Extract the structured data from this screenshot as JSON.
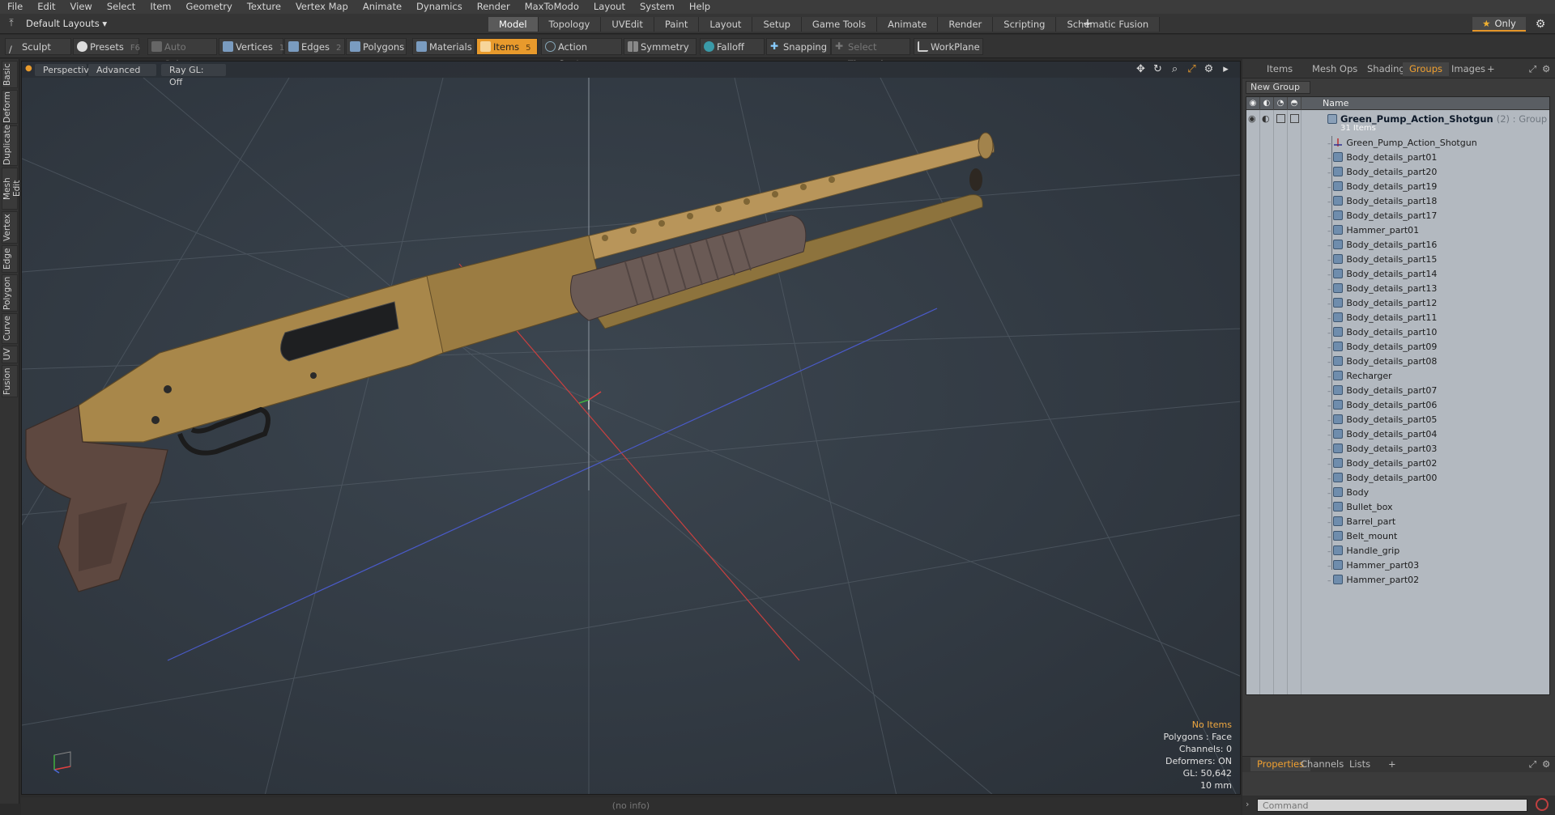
{
  "menu": [
    "File",
    "Edit",
    "View",
    "Select",
    "Item",
    "Geometry",
    "Texture",
    "Vertex Map",
    "Animate",
    "Dynamics",
    "Render",
    "MaxToModo",
    "Layout",
    "System",
    "Help"
  ],
  "layout_select": "Default Layouts",
  "workspace_tabs": [
    "Model",
    "Topology",
    "UVEdit",
    "Paint",
    "Layout",
    "Setup",
    "Game Tools",
    "Animate",
    "Render",
    "Scripting",
    "Schematic Fusion"
  ],
  "workspace_active": "Model",
  "only_label": "Only",
  "toolbar": {
    "sculpt": "Sculpt",
    "presets": "Presets",
    "presets_key": "F6",
    "auto_select": "Auto Select",
    "vertices": "Vertices",
    "vertices_key": "1",
    "edges": "Edges",
    "edges_key": "2",
    "polygons": "Polygons",
    "materials": "Materials",
    "items": "Items",
    "items_key": "5",
    "action_center": "Action Center",
    "symmetry": "Symmetry",
    "falloff": "Falloff",
    "snapping": "Snapping",
    "select_through": "Select Through",
    "workplane": "WorkPlane"
  },
  "left_tabs": [
    "Basic",
    "Deform",
    "Duplicate",
    "Mesh Edit",
    "Vertex",
    "Edge",
    "Polygon",
    "Curve",
    "UV",
    "Fusion"
  ],
  "viewport": {
    "view_mode": "Perspective",
    "shading": "Advanced",
    "raygl": "Ray GL: Off",
    "info": {
      "selection": "No Items",
      "polygons": "Polygons : Face",
      "channels": "Channels: 0",
      "deformers": "Deformers: ON",
      "gl": "GL: 50,642",
      "grid": "10 mm"
    }
  },
  "status_text": "(no info)",
  "right_panel": {
    "tabs": [
      "Items",
      "Mesh Ops",
      "Shading",
      "Groups",
      "Images"
    ],
    "active_tab": "Groups",
    "new_group": "New Group",
    "column_name": "Name",
    "group_name": "Green_Pump_Action_Shotgun",
    "group_suffix": "(2) : Group",
    "group_count": "31 Items",
    "items": [
      {
        "name": "Green_Pump_Action_Shotgun",
        "kind": "locator"
      },
      {
        "name": "Body_details_part01",
        "kind": "mesh"
      },
      {
        "name": "Body_details_part20",
        "kind": "mesh"
      },
      {
        "name": "Body_details_part19",
        "kind": "mesh"
      },
      {
        "name": "Body_details_part18",
        "kind": "mesh"
      },
      {
        "name": "Body_details_part17",
        "kind": "mesh"
      },
      {
        "name": "Hammer_part01",
        "kind": "mesh"
      },
      {
        "name": "Body_details_part16",
        "kind": "mesh"
      },
      {
        "name": "Body_details_part15",
        "kind": "mesh"
      },
      {
        "name": "Body_details_part14",
        "kind": "mesh"
      },
      {
        "name": "Body_details_part13",
        "kind": "mesh"
      },
      {
        "name": "Body_details_part12",
        "kind": "mesh"
      },
      {
        "name": "Body_details_part11",
        "kind": "mesh"
      },
      {
        "name": "Body_details_part10",
        "kind": "mesh"
      },
      {
        "name": "Body_details_part09",
        "kind": "mesh"
      },
      {
        "name": "Body_details_part08",
        "kind": "mesh"
      },
      {
        "name": "Recharger",
        "kind": "mesh"
      },
      {
        "name": "Body_details_part07",
        "kind": "mesh"
      },
      {
        "name": "Body_details_part06",
        "kind": "mesh"
      },
      {
        "name": "Body_details_part05",
        "kind": "mesh"
      },
      {
        "name": "Body_details_part04",
        "kind": "mesh"
      },
      {
        "name": "Body_details_part03",
        "kind": "mesh"
      },
      {
        "name": "Body_details_part02",
        "kind": "mesh"
      },
      {
        "name": "Body_details_part00",
        "kind": "mesh"
      },
      {
        "name": "Body",
        "kind": "mesh"
      },
      {
        "name": "Bullet_box",
        "kind": "mesh"
      },
      {
        "name": "Barrel_part",
        "kind": "mesh"
      },
      {
        "name": "Belt_mount",
        "kind": "mesh"
      },
      {
        "name": "Handle_grip",
        "kind": "mesh"
      },
      {
        "name": "Hammer_part03",
        "kind": "mesh"
      },
      {
        "name": "Hammer_part02",
        "kind": "mesh"
      }
    ],
    "bottom_tabs": [
      "Properties",
      "Channels",
      "Lists"
    ],
    "bottom_active": "Properties",
    "command_placeholder": "Command"
  },
  "colors": {
    "accent": "#e89a2c",
    "gun_body": "#a8874a",
    "grip": "#5e4840",
    "pump": "#6a5a55",
    "tree_bg": "#b3b9c0"
  }
}
